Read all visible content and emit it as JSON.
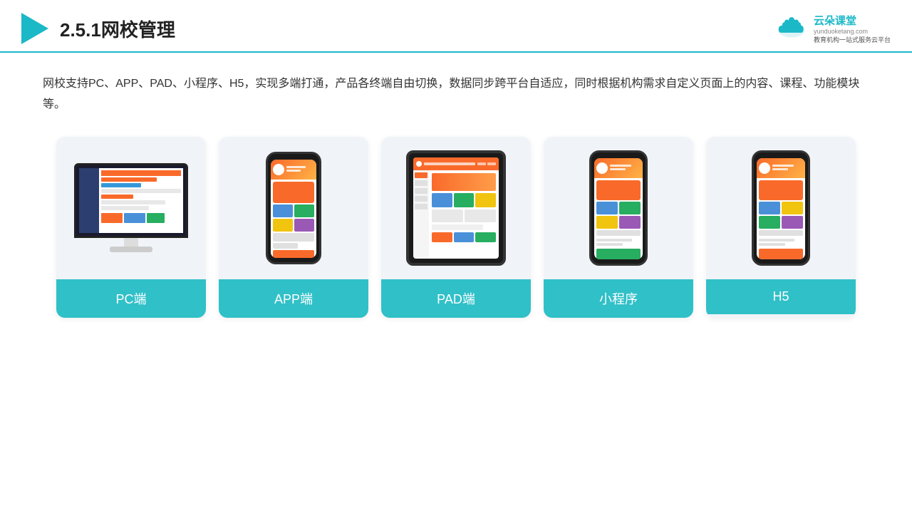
{
  "header": {
    "title": "2.5.1网校管理",
    "brand": {
      "name": "云朵课堂",
      "url": "yunduoketang.com",
      "slogan": "教育机构一站\n式服务云平台"
    }
  },
  "description": "网校支持PC、APP、PAD、小程序、H5，实现多端打通，产品各终端自由切换，数据同步跨平台自适应，同时根据机构需求自定义页面上的内容、课程、功能模块等。",
  "cards": [
    {
      "id": "pc",
      "label": "PC端"
    },
    {
      "id": "app",
      "label": "APP端"
    },
    {
      "id": "pad",
      "label": "PAD端"
    },
    {
      "id": "miniprogram",
      "label": "小程序"
    },
    {
      "id": "h5",
      "label": "H5"
    }
  ],
  "colors": {
    "accent": "#1bb8c8",
    "card_bg": "#f0f4f8",
    "card_label": "#30c0c8"
  }
}
